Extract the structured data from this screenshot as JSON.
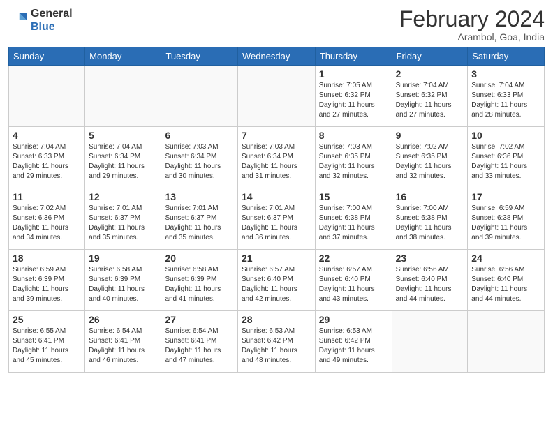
{
  "header": {
    "logo_line1": "General",
    "logo_line2": "Blue",
    "title": "February 2024",
    "subtitle": "Arambol, Goa, India"
  },
  "days_of_week": [
    "Sunday",
    "Monday",
    "Tuesday",
    "Wednesday",
    "Thursday",
    "Friday",
    "Saturday"
  ],
  "weeks": [
    [
      {
        "num": "",
        "info": ""
      },
      {
        "num": "",
        "info": ""
      },
      {
        "num": "",
        "info": ""
      },
      {
        "num": "",
        "info": ""
      },
      {
        "num": "1",
        "info": "Sunrise: 7:05 AM\nSunset: 6:32 PM\nDaylight: 11 hours\nand 27 minutes."
      },
      {
        "num": "2",
        "info": "Sunrise: 7:04 AM\nSunset: 6:32 PM\nDaylight: 11 hours\nand 27 minutes."
      },
      {
        "num": "3",
        "info": "Sunrise: 7:04 AM\nSunset: 6:33 PM\nDaylight: 11 hours\nand 28 minutes."
      }
    ],
    [
      {
        "num": "4",
        "info": "Sunrise: 7:04 AM\nSunset: 6:33 PM\nDaylight: 11 hours\nand 29 minutes."
      },
      {
        "num": "5",
        "info": "Sunrise: 7:04 AM\nSunset: 6:34 PM\nDaylight: 11 hours\nand 29 minutes."
      },
      {
        "num": "6",
        "info": "Sunrise: 7:03 AM\nSunset: 6:34 PM\nDaylight: 11 hours\nand 30 minutes."
      },
      {
        "num": "7",
        "info": "Sunrise: 7:03 AM\nSunset: 6:34 PM\nDaylight: 11 hours\nand 31 minutes."
      },
      {
        "num": "8",
        "info": "Sunrise: 7:03 AM\nSunset: 6:35 PM\nDaylight: 11 hours\nand 32 minutes."
      },
      {
        "num": "9",
        "info": "Sunrise: 7:02 AM\nSunset: 6:35 PM\nDaylight: 11 hours\nand 32 minutes."
      },
      {
        "num": "10",
        "info": "Sunrise: 7:02 AM\nSunset: 6:36 PM\nDaylight: 11 hours\nand 33 minutes."
      }
    ],
    [
      {
        "num": "11",
        "info": "Sunrise: 7:02 AM\nSunset: 6:36 PM\nDaylight: 11 hours\nand 34 minutes."
      },
      {
        "num": "12",
        "info": "Sunrise: 7:01 AM\nSunset: 6:37 PM\nDaylight: 11 hours\nand 35 minutes."
      },
      {
        "num": "13",
        "info": "Sunrise: 7:01 AM\nSunset: 6:37 PM\nDaylight: 11 hours\nand 35 minutes."
      },
      {
        "num": "14",
        "info": "Sunrise: 7:01 AM\nSunset: 6:37 PM\nDaylight: 11 hours\nand 36 minutes."
      },
      {
        "num": "15",
        "info": "Sunrise: 7:00 AM\nSunset: 6:38 PM\nDaylight: 11 hours\nand 37 minutes."
      },
      {
        "num": "16",
        "info": "Sunrise: 7:00 AM\nSunset: 6:38 PM\nDaylight: 11 hours\nand 38 minutes."
      },
      {
        "num": "17",
        "info": "Sunrise: 6:59 AM\nSunset: 6:38 PM\nDaylight: 11 hours\nand 39 minutes."
      }
    ],
    [
      {
        "num": "18",
        "info": "Sunrise: 6:59 AM\nSunset: 6:39 PM\nDaylight: 11 hours\nand 39 minutes."
      },
      {
        "num": "19",
        "info": "Sunrise: 6:58 AM\nSunset: 6:39 PM\nDaylight: 11 hours\nand 40 minutes."
      },
      {
        "num": "20",
        "info": "Sunrise: 6:58 AM\nSunset: 6:39 PM\nDaylight: 11 hours\nand 41 minutes."
      },
      {
        "num": "21",
        "info": "Sunrise: 6:57 AM\nSunset: 6:40 PM\nDaylight: 11 hours\nand 42 minutes."
      },
      {
        "num": "22",
        "info": "Sunrise: 6:57 AM\nSunset: 6:40 PM\nDaylight: 11 hours\nand 43 minutes."
      },
      {
        "num": "23",
        "info": "Sunrise: 6:56 AM\nSunset: 6:40 PM\nDaylight: 11 hours\nand 44 minutes."
      },
      {
        "num": "24",
        "info": "Sunrise: 6:56 AM\nSunset: 6:40 PM\nDaylight: 11 hours\nand 44 minutes."
      }
    ],
    [
      {
        "num": "25",
        "info": "Sunrise: 6:55 AM\nSunset: 6:41 PM\nDaylight: 11 hours\nand 45 minutes."
      },
      {
        "num": "26",
        "info": "Sunrise: 6:54 AM\nSunset: 6:41 PM\nDaylight: 11 hours\nand 46 minutes."
      },
      {
        "num": "27",
        "info": "Sunrise: 6:54 AM\nSunset: 6:41 PM\nDaylight: 11 hours\nand 47 minutes."
      },
      {
        "num": "28",
        "info": "Sunrise: 6:53 AM\nSunset: 6:42 PM\nDaylight: 11 hours\nand 48 minutes."
      },
      {
        "num": "29",
        "info": "Sunrise: 6:53 AM\nSunset: 6:42 PM\nDaylight: 11 hours\nand 49 minutes."
      },
      {
        "num": "",
        "info": ""
      },
      {
        "num": "",
        "info": ""
      }
    ]
  ]
}
